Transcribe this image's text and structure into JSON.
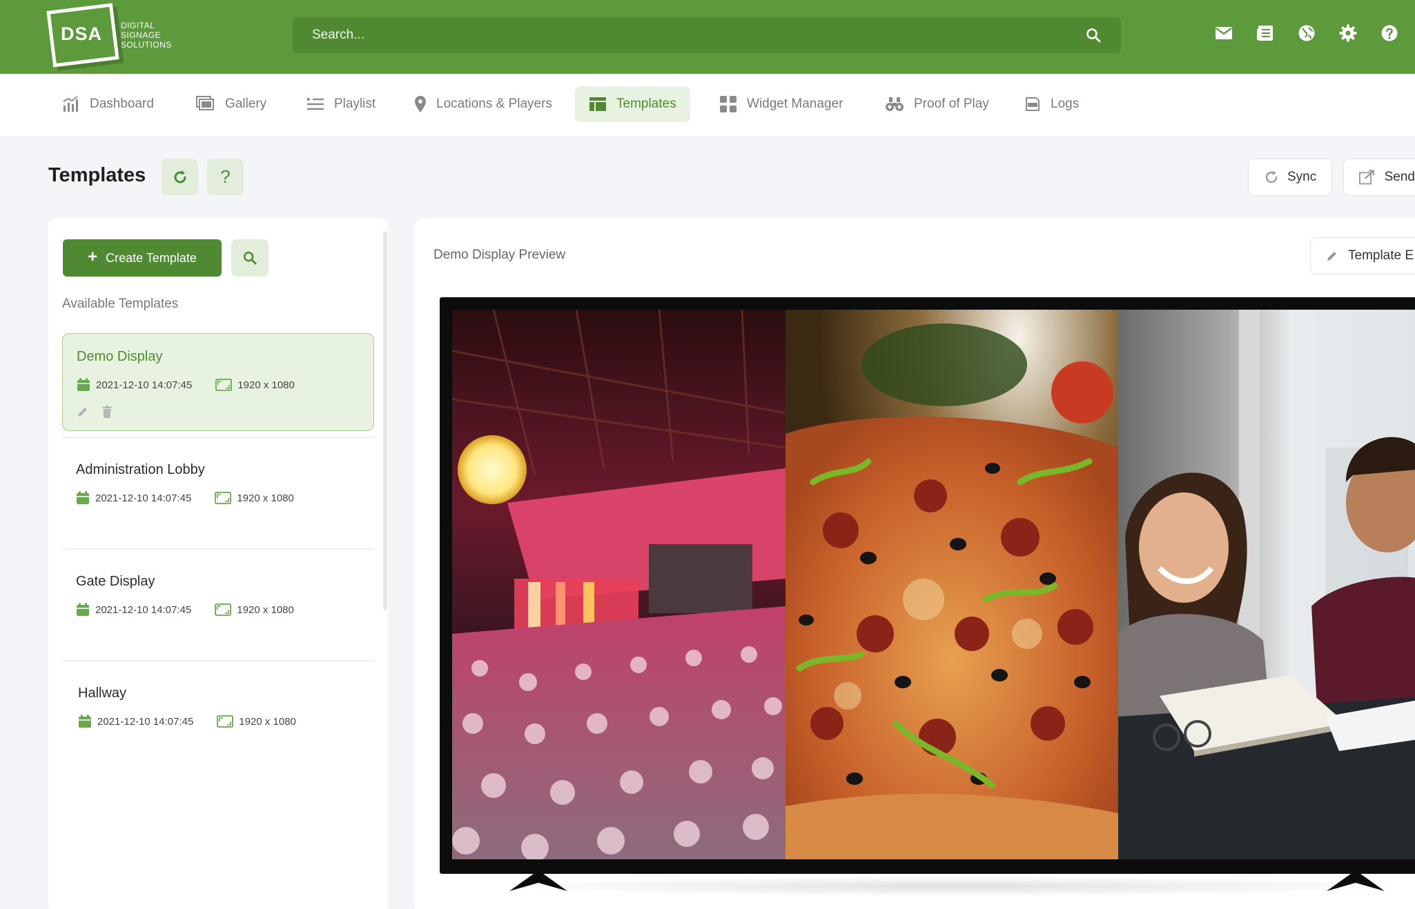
{
  "header": {
    "logo_text": "DSA",
    "logo_sub": [
      "DIGITAL",
      "SIGNAGE",
      "SOLUTIONS"
    ],
    "search_placeholder": "Search...",
    "icons": [
      "mail-icon",
      "news-icon",
      "globe-icon",
      "gear-icon",
      "help-icon"
    ],
    "brand_color": "#5c9a3c"
  },
  "nav": {
    "items": [
      {
        "label": "Dashboard",
        "icon": "bar-chart-icon"
      },
      {
        "label": "Gallery",
        "icon": "gallery-icon"
      },
      {
        "label": "Playlist",
        "icon": "playlist-icon"
      },
      {
        "label": "Locations & Players",
        "icon": "map-pin-icon"
      },
      {
        "label": "Templates",
        "icon": "template-icon",
        "active": true
      },
      {
        "label": "Widget Manager",
        "icon": "widget-icon"
      },
      {
        "label": "Proof of Play",
        "icon": "binoculars-icon"
      },
      {
        "label": "Logs",
        "icon": "log-icon"
      }
    ]
  },
  "page": {
    "title": "Templates",
    "help_glyph": "?",
    "actions": {
      "sync": "Sync",
      "send": "Send"
    }
  },
  "sidebar": {
    "create_label": "Create Template",
    "section_title": "Available Templates",
    "templates": [
      {
        "name": "Demo Display",
        "date": "2021-12-10 14:07:45",
        "resolution": "1920 x 1080",
        "active": true
      },
      {
        "name": "Administration Lobby",
        "date": "2021-12-10 14:07:45",
        "resolution": "1920 x 1080"
      },
      {
        "name": "Gate Display",
        "date": "2021-12-10 14:07:45",
        "resolution": "1920 x 1080"
      },
      {
        "name": "Hallway",
        "date": "2021-12-10 14:07:45",
        "resolution": "1920 x 1080"
      }
    ]
  },
  "preview": {
    "label": "Demo Display Preview",
    "editor_button": "Template E",
    "zones": [
      "event-hall-image",
      "pizza-image",
      "students-image"
    ]
  }
}
